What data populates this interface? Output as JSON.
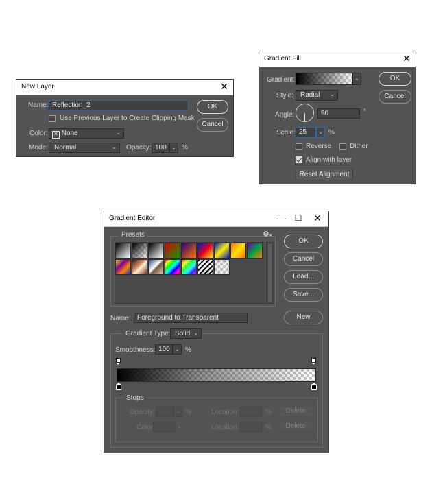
{
  "new_layer": {
    "title": "New Layer",
    "name_label": "Name:",
    "name_value": "Reflection_2",
    "clip_label": "Use Previous Layer to Create Clipping Mask",
    "color_label": "Color:",
    "color_value": "None",
    "mode_label": "Mode:",
    "mode_value": "Normal",
    "opacity_label": "Opacity:",
    "opacity_value": "100",
    "percent": "%",
    "ok": "OK",
    "cancel": "Cancel"
  },
  "gradient_fill": {
    "title": "Gradient Fill",
    "gradient_label": "Gradient:",
    "style_label": "Style:",
    "style_value": "Radial",
    "angle_label": "Angle:",
    "angle_value": "90",
    "degree": "°",
    "scale_label": "Scale:",
    "scale_value": "25",
    "percent": "%",
    "reverse_label": "Reverse",
    "dither_label": "Dither",
    "align_label": "Align with layer",
    "align_checked": true,
    "reset_label": "Reset Alignment",
    "ok": "OK",
    "cancel": "Cancel"
  },
  "gradient_editor": {
    "title": "Gradient Editor",
    "presets_label": "Presets",
    "ok": "OK",
    "cancel": "Cancel",
    "load": "Load...",
    "save": "Save...",
    "name_label": "Name:",
    "name_value": "Foreground to Transparent",
    "new_label": "New",
    "type_label": "Gradient Type:",
    "type_value": "Solid",
    "smooth_label": "Smoothness:",
    "smooth_value": "100",
    "percent": "%",
    "stops_label": "Stops",
    "opacity_label": "Opacity:",
    "location_label": "Location:",
    "color_label": "Color:",
    "delete_label": "Delete",
    "presets": [
      {
        "name": "Foreground to Background"
      },
      {
        "name": "Foreground to Transparent"
      },
      {
        "name": "Black, White"
      },
      {
        "name": "Red, Green"
      },
      {
        "name": "Violet, Orange"
      },
      {
        "name": "Blue, Red, Yellow"
      },
      {
        "name": "Blue, Yellow, Blue"
      },
      {
        "name": "Orange, Yellow, Orange"
      },
      {
        "name": "Violet, Green, Orange"
      },
      {
        "name": "Yellow, Violet, Orange, Blue"
      },
      {
        "name": "Copper"
      },
      {
        "name": "Chrome"
      },
      {
        "name": "Spectrum"
      },
      {
        "name": "Transparent Rainbow"
      },
      {
        "name": "Transparent Stripes"
      },
      {
        "name": "Neutral Density"
      }
    ]
  },
  "colors": {
    "dialog_bg": "#535353",
    "field_bg": "#454545",
    "focus_border": "#1b6fc2",
    "text": "#d6d6d6"
  }
}
